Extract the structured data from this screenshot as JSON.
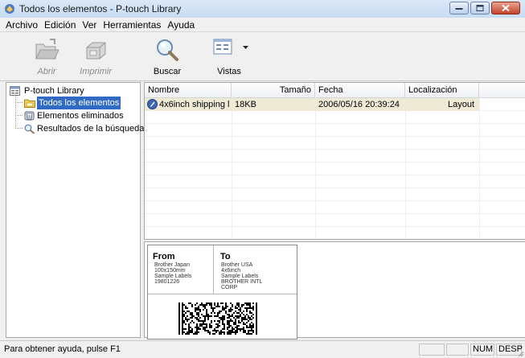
{
  "window": {
    "title": "Todos los elementos - P-touch Library"
  },
  "menu": [
    "Archivo",
    "Edición",
    "Ver",
    "Herramientas",
    "Ayuda"
  ],
  "toolbar": {
    "open_label": "Abrir",
    "print_label": "Imprimir",
    "search_label": "Buscar",
    "views_label": "Vistas"
  },
  "tree": {
    "root": "P-touch Library",
    "items": [
      "Todos los elementos",
      "Elementos eliminados",
      "Resultados de la búsqueda"
    ]
  },
  "list": {
    "columns": [
      "Nombre",
      "Tamaño",
      "Fecha",
      "Localización"
    ],
    "rows": [
      {
        "name": "4x6inch shipping l...",
        "size": "18KB",
        "date": "2006/05/16 20:39:24",
        "location": "Layout"
      }
    ]
  },
  "preview": {
    "from_title": "From",
    "from_lines": [
      "Brother Japan",
      "100x150mm",
      "Sample Labels",
      "19801226"
    ],
    "to_title": "To",
    "to_lines": [
      "Brother USA",
      "4x6inch",
      "Sample Labels",
      "BROTHER INTL",
      "CORP"
    ]
  },
  "status": {
    "help_text": "Para obtener ayuda, pulse F1",
    "num": "NUM",
    "desp": "DESP"
  },
  "colors": {
    "selection": "#316ac5",
    "row_highlight": "#eeead6",
    "close_button": "#c3442a"
  }
}
